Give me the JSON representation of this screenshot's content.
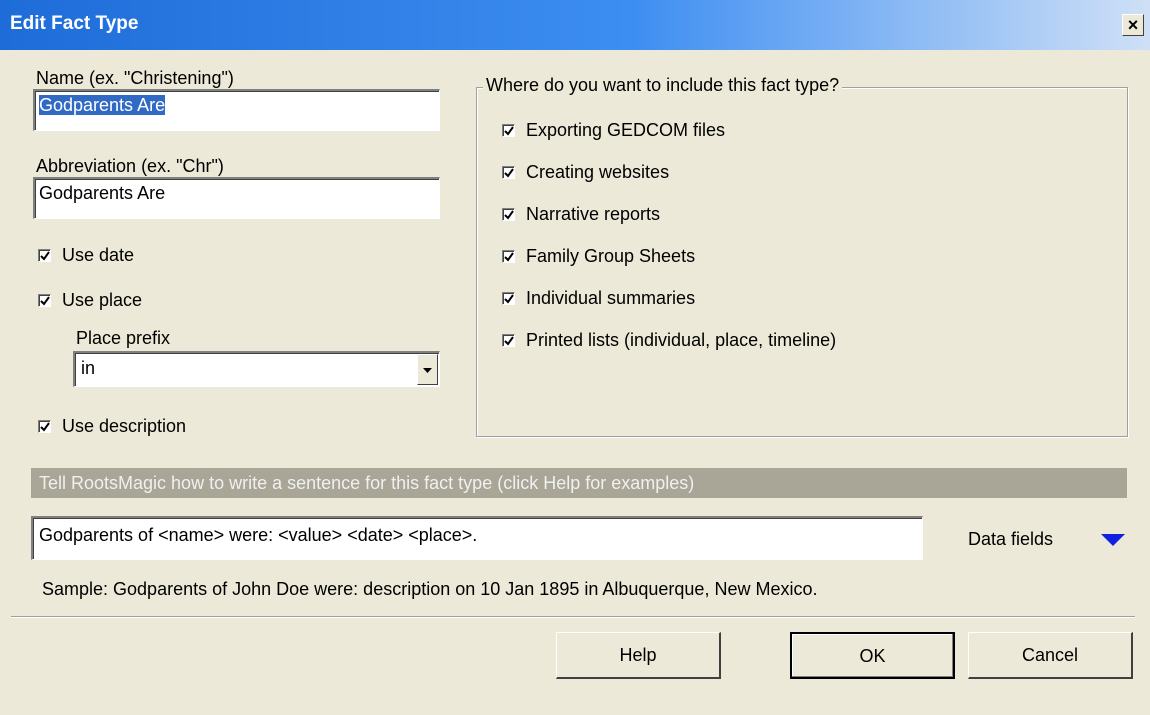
{
  "window": {
    "title": "Edit Fact Type",
    "close_glyph": "×"
  },
  "name_field": {
    "label": "Name (ex. \"Christening\")",
    "value": "Godparents Are"
  },
  "abbrev_field": {
    "label": "Abbreviation (ex. \"Chr\")",
    "value": "Godparents Are"
  },
  "options": {
    "use_date": {
      "label": "Use date",
      "checked": true
    },
    "use_place": {
      "label": "Use place",
      "checked": true
    },
    "place_prefix_label": "Place prefix",
    "place_prefix_value": "in",
    "use_description": {
      "label": "Use description",
      "checked": true
    }
  },
  "include_group": {
    "title": "Where do you want to include this fact type?",
    "items": [
      {
        "label": "Exporting GEDCOM files",
        "checked": true
      },
      {
        "label": "Creating websites",
        "checked": true
      },
      {
        "label": "Narrative reports",
        "checked": true
      },
      {
        "label": "Family Group Sheets",
        "checked": true
      },
      {
        "label": "Individual summaries",
        "checked": true
      },
      {
        "label": "Printed lists (individual, place, timeline)",
        "checked": true
      }
    ]
  },
  "sentence": {
    "banner": "Tell RootsMagic how to write a sentence for this fact type (click Help for examples)",
    "template": "Godparents of <name> were: <value> <date> <place>.",
    "data_fields_label": "Data fields",
    "sample": "Sample: Godparents of John Doe were: description on 10 Jan 1895 in Albuquerque, New Mexico."
  },
  "buttons": {
    "help": "Help",
    "ok": "OK",
    "cancel": "Cancel"
  },
  "colors": {
    "accent": "#316ac5",
    "dialog_bg": "#ece9d8",
    "banner_bg": "#a9a597",
    "arrow": "#1020e0"
  }
}
